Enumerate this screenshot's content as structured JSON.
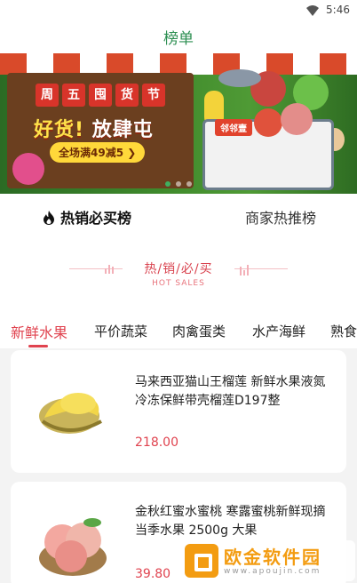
{
  "status_bar": {
    "time": "5:46",
    "wifi_icon": "wifi-icon"
  },
  "header": {
    "title": "榜单"
  },
  "banner": {
    "sign_chars": [
      "周",
      "五",
      "囤",
      "货",
      "节"
    ],
    "slogan_prefix": "好货!",
    "slogan_suffix": "放肆屯",
    "promo": "全场满49减5 ❯",
    "basket_label": "邻邻壹",
    "active_dot": 0,
    "dot_count": 3
  },
  "rank_tabs": {
    "active_label": "热销必买榜",
    "active_icon": "fire-icon",
    "other_label": "商家热推榜"
  },
  "hot_sales": {
    "title": "热/销/必/买",
    "subtitle": "HOT SALES"
  },
  "category_tabs": [
    "新鲜水果",
    "平价蔬菜",
    "肉禽蛋类",
    "水产海鲜",
    "熟食"
  ],
  "products": [
    {
      "name": "马来西亚猫山王榴莲 新鲜水果液氮冷冻保鲜带壳榴莲D197整",
      "price": "218.00",
      "image": "durian-image"
    },
    {
      "name": "金秋红蜜水蜜桃 寒露蜜桃新鲜现摘当季水果 2500g 大果",
      "price": "39.80",
      "image": "peach-image"
    }
  ],
  "watermark": {
    "text": "欧金软件园",
    "url": "www.apoujin.com"
  },
  "colors": {
    "accent": "#e0434f",
    "title_green": "#2d8f52",
    "promo_yellow": "#ffd83a"
  }
}
